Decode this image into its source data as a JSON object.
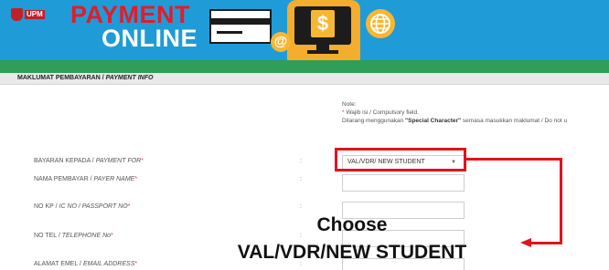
{
  "banner": {
    "logo_text": "UPM",
    "title_line1": "PAYMENT",
    "title_line2": "ONLINE",
    "at_symbol": "@",
    "dollar_symbol": "$"
  },
  "section": {
    "title_main": "MAKLUMAT PEMBAYARAN / ",
    "title_italic": "PAYMENT INFO"
  },
  "note": {
    "heading": "Note:",
    "required_mark": "*",
    "required_text": " Wajib isi / Compulsory field.",
    "prefix": "Dilarang menggunakan ",
    "special": "\"Special Character\"",
    "suffix": " semasa masukkan maklumat / Do not u"
  },
  "form": {
    "colon": ":",
    "required_mark": "*",
    "fields": [
      {
        "label_main": "BAYARAN KEPADA / ",
        "label_italic": "PAYMENT FOR"
      },
      {
        "label_main": "NAMA PEMBAYAR / ",
        "label_italic": "PAYER NAME"
      },
      {
        "label_main": "NO KP / ",
        "label_italic": "IC NO / PASSPORT NO"
      },
      {
        "label_main": "NO TEL / ",
        "label_italic": "TELEPHONE No"
      },
      {
        "label_main": "ALAMAT EMEL / ",
        "label_italic": "EMAIL ADDRESS"
      }
    ],
    "payment_for_value": "VAL/VDR/ NEW STUDENT",
    "chevron": "▼"
  },
  "callout": {
    "line1": "Choose",
    "line2": "VAL/VDR/NEW STUDENT"
  },
  "colors": {
    "banner_blue": "#1f9bd7",
    "green_bar": "#2f9e58",
    "accent_red": "#e0141b",
    "icon_yellow": "#f7b733"
  }
}
